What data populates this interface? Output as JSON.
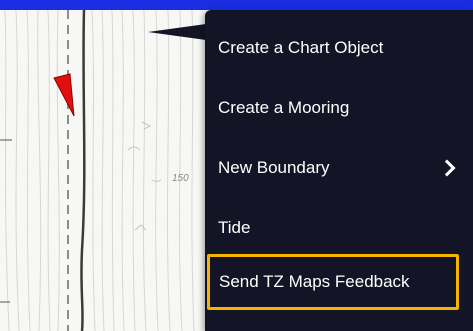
{
  "map": {
    "depth_sounding": "150",
    "icons": [
      "boat-icon"
    ]
  },
  "context_menu": {
    "items": [
      {
        "label": "Create a Chart Object",
        "has_submenu": false,
        "highlighted": false
      },
      {
        "label": "Create a Mooring",
        "has_submenu": false,
        "highlighted": false
      },
      {
        "label": "New Boundary",
        "has_submenu": true,
        "highlighted": false
      },
      {
        "label": "Tide",
        "has_submenu": false,
        "highlighted": false
      },
      {
        "label": "Send TZ Maps Feedback",
        "has_submenu": false,
        "highlighted": true
      }
    ],
    "colors": {
      "background": "#131527",
      "text": "#ffffff",
      "highlight_border": "#f4b400"
    }
  },
  "colors": {
    "top_bar": "#1a2de0",
    "boat": "#e01010",
    "map_background": "#f7f7f5"
  }
}
